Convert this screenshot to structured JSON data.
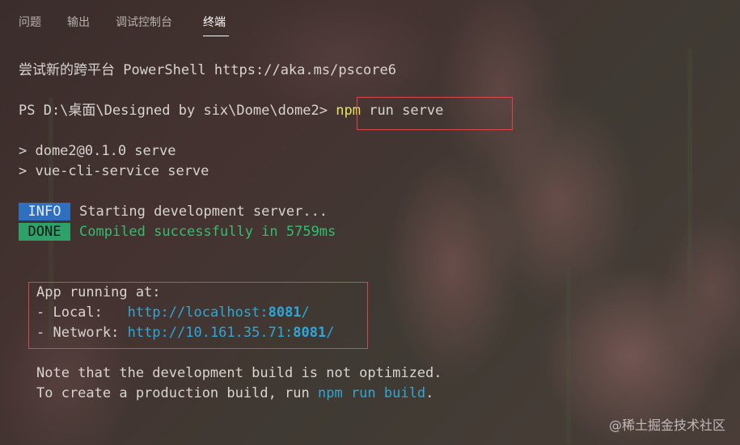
{
  "tabs": [
    {
      "label": "问题",
      "active": false
    },
    {
      "label": "输出",
      "active": false
    },
    {
      "label": "调试控制台",
      "active": false
    },
    {
      "label": "终端",
      "active": true
    }
  ],
  "terminal": {
    "banner": "尝试新的跨平台 PowerShell https://aka.ms/pscore6",
    "prompt": "PS D:\\桌面\\Designed by six\\Dome\\dome2>",
    "command_npm": "npm",
    "command_rest": " run serve",
    "script_line1": "> dome2@0.1.0 serve",
    "script_line2": "> vue-cli-service serve",
    "info_badge": "INFO",
    "info_text": "Starting development server...",
    "done_badge": "DONE",
    "done_text": "Compiled successfully in 5759ms",
    "app_running": "App running at:",
    "local_label": "- Local:   ",
    "local_url_prefix": "http://localhost:",
    "local_port": "8081",
    "local_url_suffix": "/",
    "network_label": "- Network: ",
    "network_url_prefix": "http://10.161.35.71:",
    "network_port": "8081",
    "network_url_suffix": "/",
    "note_line": "Note that the development build is not optimized.",
    "prod_line_prefix": "To create a production build, run ",
    "prod_command": "npm run build",
    "prod_line_suffix": "."
  },
  "watermark": "@稀土掘金技术社区",
  "colors": {
    "highlight_box": "#d9474a",
    "npm_keyword": "#e5e55b",
    "link": "#2ba8d8",
    "success": "#2fbf6f",
    "info_badge": "#2f6fbf",
    "done_badge": "#2fa06a"
  }
}
